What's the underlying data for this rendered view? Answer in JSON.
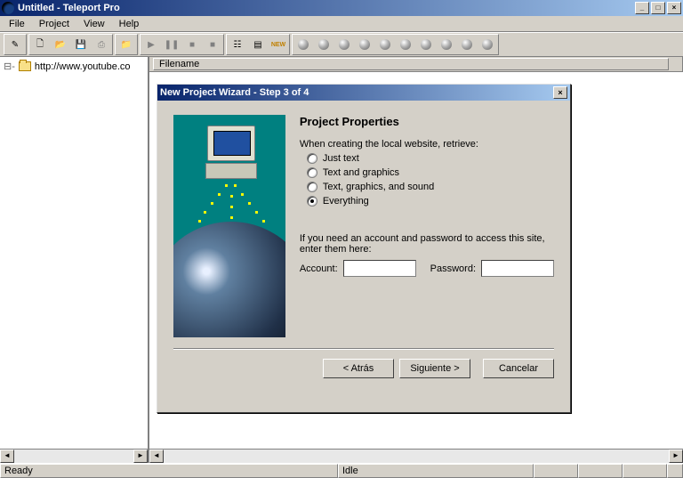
{
  "window": {
    "title": "Untitled - Teleport Pro"
  },
  "menu": {
    "file": "File",
    "project": "Project",
    "view": "View",
    "help": "Help"
  },
  "toolbar": {
    "new_label": "NEW"
  },
  "tree": {
    "item0": "http://www.youtube.co"
  },
  "columns": {
    "filename": "Filename"
  },
  "status": {
    "ready": "Ready",
    "idle": "Idle"
  },
  "dialog": {
    "title": "New Project Wizard - Step 3 of 4",
    "heading": "Project Properties",
    "retrieve_prompt": "When creating the local website, retrieve:",
    "opt_just_text": "Just text",
    "opt_text_graphics": "Text and graphics",
    "opt_text_graphics_sound": "Text, graphics, and sound",
    "opt_everything": "Everything",
    "account_prompt": "If you need an account and password to access this site, enter them here:",
    "account_label": "Account:",
    "password_label": "Password:",
    "back": "< Atrás",
    "next": "Siguiente >",
    "cancel": "Cancelar"
  }
}
